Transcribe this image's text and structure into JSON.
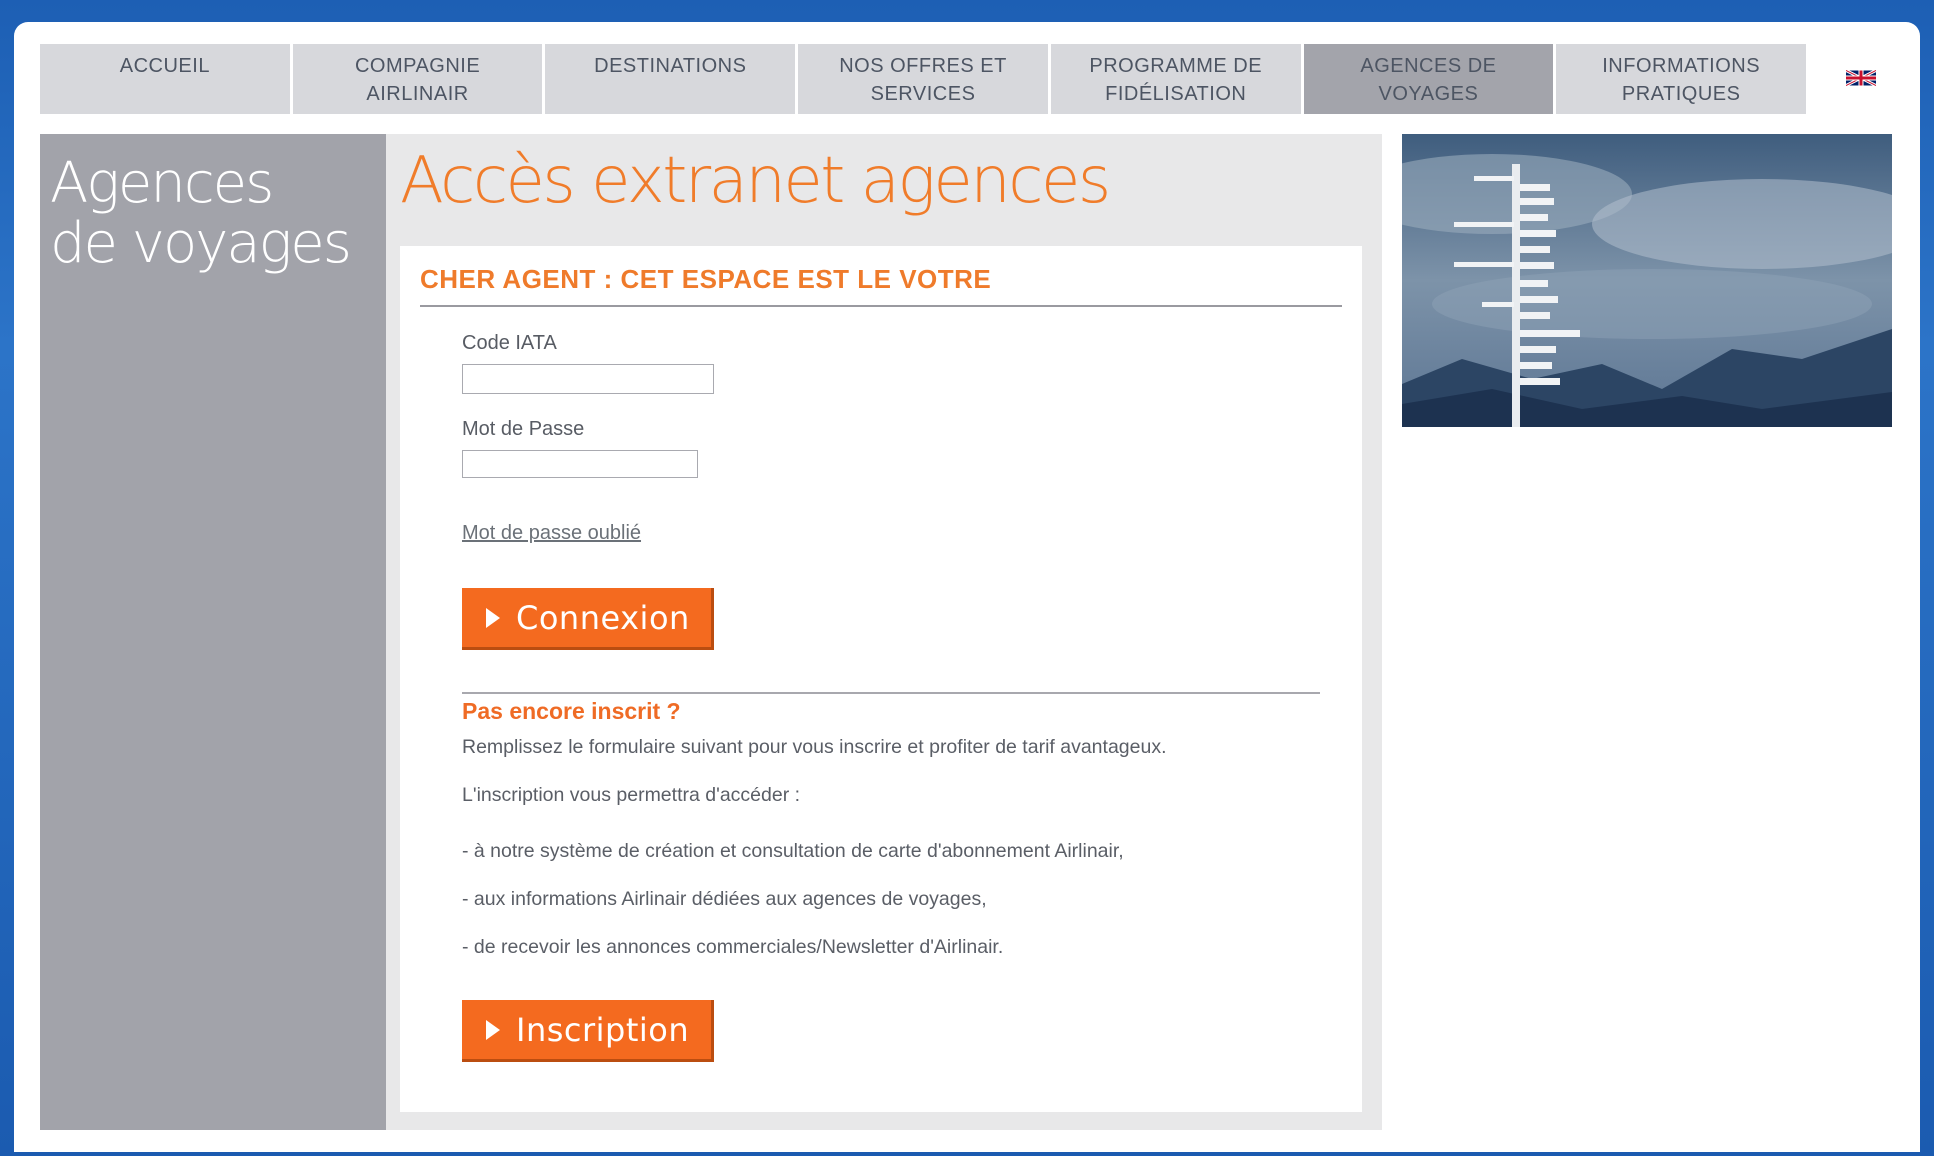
{
  "nav": {
    "items": [
      {
        "label": "ACCUEIL"
      },
      {
        "label": "COMPAGNIE\nAIRLINAIR"
      },
      {
        "label": "DESTINATIONS"
      },
      {
        "label": "NOS OFFRES ET\nSERVICES"
      },
      {
        "label": "PROGRAMME DE\nFIDÉLISATION"
      },
      {
        "label": "AGENCES DE\nVOYAGES"
      },
      {
        "label": "INFORMATIONS\nPRATIQUES"
      }
    ],
    "active_index": 5,
    "language_flag": "uk-flag-icon"
  },
  "sidebar": {
    "title_line1": "Agences",
    "title_line2": "de voyages"
  },
  "main": {
    "title": "Accès extranet agences",
    "panel_heading": "CHER AGENT : CET ESPACE EST LE VOTRE",
    "iata_label": "Code IATA",
    "iata_value": "",
    "password_label": "Mot de Passe",
    "password_value": "",
    "forgot_link": "Mot de passe oublié",
    "login_button": "Connexion",
    "signup_heading": "Pas encore inscrit ?",
    "signup_intro": "Remplissez le formulaire suivant pour vous inscrire et profiter de tarif avantageux.",
    "signup_access": "L'inscription vous permettra d'accéder :",
    "benefits": [
      "- à notre système de création et consultation de carte d'abonnement Airlinair,",
      "- aux informations Airlinair dédiées aux agences de voyages,",
      "- de recevoir les annonces commerciales/Newsletter d'Airlinair."
    ],
    "signup_button": "Inscription"
  },
  "colors": {
    "accent_orange": "#f46a1f",
    "title_orange": "#f07c2a",
    "nav_bg": "#d7d8dc",
    "nav_active": "#a3a4ab",
    "sidebar_bg": "#a2a3aa",
    "page_blue": "#1d5fb4"
  }
}
